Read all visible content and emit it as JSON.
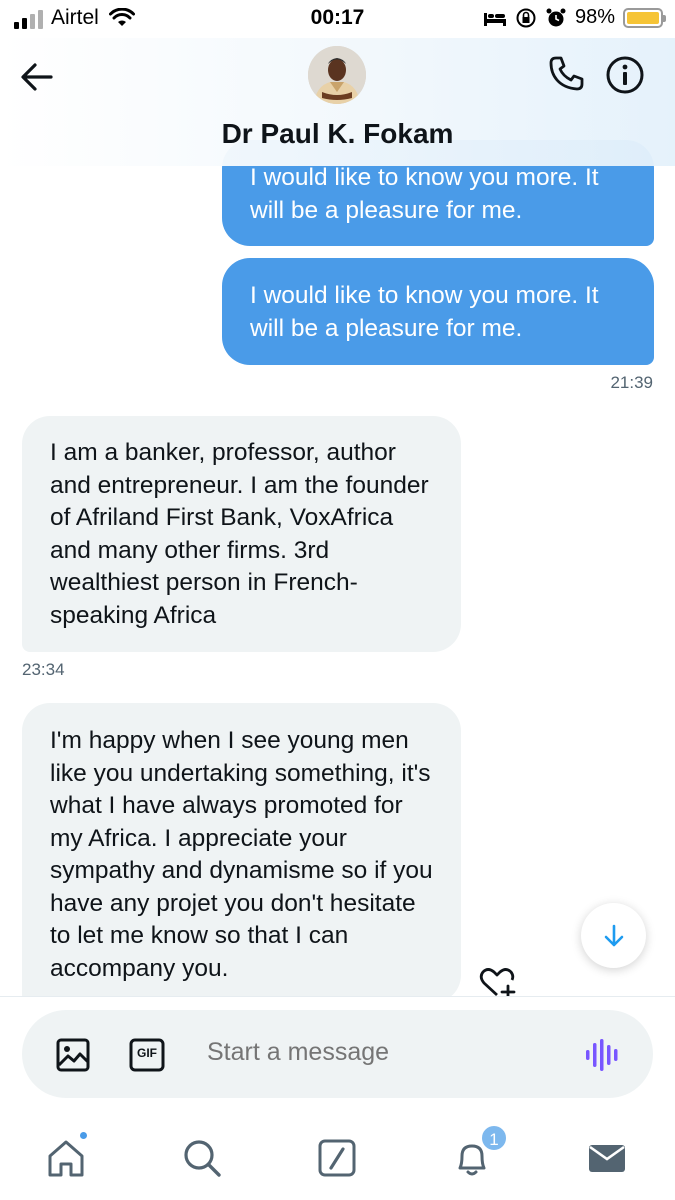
{
  "status_bar": {
    "carrier": "Airtel",
    "time": "00:17",
    "battery_percent": "98%",
    "signal_bars": 2,
    "battery_fill": 0.98
  },
  "header": {
    "contact_name": "Dr Paul K. Fokam",
    "icons": [
      "back-arrow-icon",
      "avatar",
      "phone-icon",
      "info-icon"
    ]
  },
  "messages": [
    {
      "direction": "sent",
      "text": "I would like to know you more. It will be a pleasure for me."
    },
    {
      "direction": "sent",
      "text": "I would like to know you more. It will be a pleasure for me.",
      "timestamp": "21:39"
    },
    {
      "direction": "received",
      "text": "I am a banker, professor, author and entrepreneur.  I am the founder of Afriland First Bank, VoxAfrica and many other firms. 3rd wealthiest person in French-speaking Africa",
      "timestamp": "23:34"
    },
    {
      "direction": "received",
      "text": "I'm happy when I see young men like you undertaking something, it's what I have always promoted for my Africa. I appreciate your sympathy and dynamisme so if you have any projet you don't hesitate to let me know so that I can accompany you."
    }
  ],
  "composer": {
    "placeholder": "Start a message",
    "gif_label": "GIF"
  },
  "nav": {
    "items": [
      "home-icon",
      "search-icon",
      "spaces-icon",
      "notifications-icon",
      "messages-icon"
    ],
    "notification_count": "1"
  },
  "colors": {
    "sent_bubble": "#4a9be8",
    "received_bubble": "#eff3f4",
    "accent": "#1d9bf0",
    "voice_icon": "#7856ff",
    "battery": "#f6c436"
  }
}
